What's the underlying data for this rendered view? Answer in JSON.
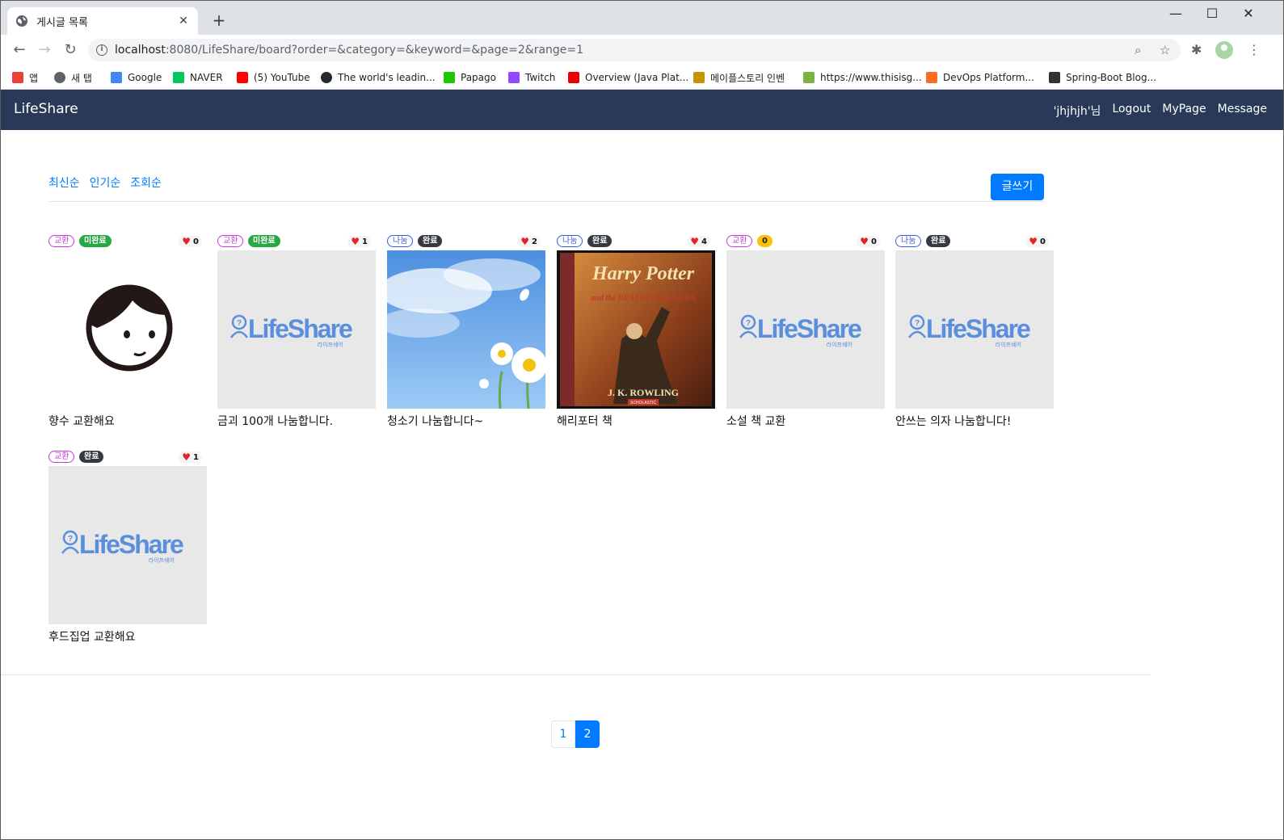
{
  "browser": {
    "tab_title": "게시글 목록",
    "url_host": "localhost",
    "url_rest": ":8080/LifeShare/board?order=&category=&keyword=&page=2&range=1",
    "bookmarks": [
      {
        "label": "앱",
        "icon": "apps-grid-icon",
        "color": "#ea4335"
      },
      {
        "label": "새 탭",
        "icon": "globe-icon",
        "color": "#5f6368"
      },
      {
        "label": "Google",
        "icon": "google-icon",
        "color": "#4285f4"
      },
      {
        "label": "NAVER",
        "icon": "naver-icon",
        "color": "#03c75a"
      },
      {
        "label": "(5) YouTube",
        "icon": "youtube-icon",
        "color": "#ff0000"
      },
      {
        "label": "The world's leadin...",
        "icon": "github-icon",
        "color": "#24292e"
      },
      {
        "label": "Papago",
        "icon": "papago-icon",
        "color": "#1ec800"
      },
      {
        "label": "Twitch",
        "icon": "twitch-icon",
        "color": "#9146ff"
      },
      {
        "label": "Overview (Java Plat...",
        "icon": "oracle-icon",
        "color": "#e00"
      },
      {
        "label": "메이플스토리 인벤",
        "icon": "inven-icon",
        "color": "#c79200"
      },
      {
        "label": "https://www.thisisg...",
        "icon": "tetris-icon",
        "color": "#7cb342"
      },
      {
        "label": "DevOps Platform...",
        "icon": "gitlab-icon",
        "color": "#fc6d26"
      },
      {
        "label": "Spring-Boot Blog...",
        "icon": "dots-icon",
        "color": "#333"
      }
    ]
  },
  "navbar": {
    "brand": "LifeShare",
    "user": "'jhjhjh'님",
    "logout": "Logout",
    "mypage": "MyPage",
    "message": "Message"
  },
  "sort": [
    "최신순",
    "인기순",
    "조회순"
  ],
  "write_label": "글쓰기",
  "posts": [
    {
      "category": "교환",
      "category_type": "exchange",
      "state": "미완료",
      "state_type": "pending",
      "likes": "0",
      "title": "향수 교환해요",
      "image": "face-avatar"
    },
    {
      "category": "교환",
      "category_type": "exchange",
      "state": "미완료",
      "state_type": "pending",
      "likes": "1",
      "title": "금괴 100개 나눔합니다.",
      "image": "lifeshare-logo"
    },
    {
      "category": "나눔",
      "category_type": "share",
      "state": "완료",
      "state_type": "done",
      "likes": "2",
      "title": "청소기 나눔합니다~",
      "image": "sky-flowers"
    },
    {
      "category": "나눔",
      "category_type": "share",
      "state": "완료",
      "state_type": "done",
      "likes": "4",
      "title": "해리포터 책",
      "image": "harry-potter-book"
    },
    {
      "category": "교환",
      "category_type": "exchange",
      "state": "0",
      "state_type": "zero",
      "likes": "0",
      "title": "소설 책 교환",
      "image": "lifeshare-logo"
    },
    {
      "category": "나눔",
      "category_type": "share",
      "state": "완료",
      "state_type": "done",
      "likes": "0",
      "title": "안쓰는 의자 나눔합니다!",
      "image": "lifeshare-logo"
    },
    {
      "category": "교환",
      "category_type": "exchange",
      "state": "완료",
      "state_type": "done",
      "likes": "1",
      "title": "후드집업 교환해요",
      "image": "lifeshare-logo"
    }
  ],
  "placeholder_logo": {
    "text": "LifeShare",
    "sub": "라이프쉐어",
    "color": "#5b8fde"
  },
  "book_cover": {
    "title": "Harry Potter",
    "subtitle": "and the DEATHLY HALLOWS",
    "author": "J. K. ROWLING",
    "publisher": "SCHOLASTIC"
  },
  "pagination": [
    "1",
    "2"
  ],
  "current_page": "2"
}
